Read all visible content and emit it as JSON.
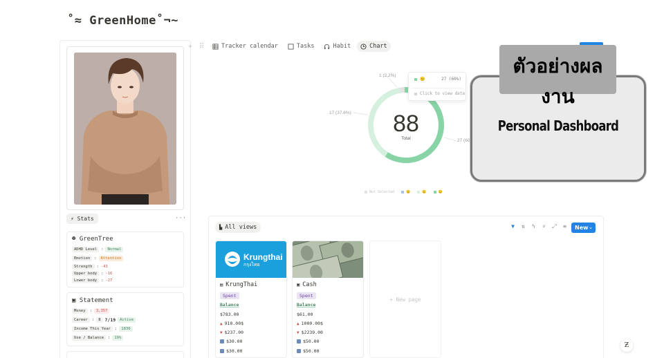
{
  "page": {
    "title": "˚≈ GreenHome˚¬~"
  },
  "toolbar": {
    "tabs": [
      {
        "label": "Tracker calendar",
        "icon": "table-icon",
        "active": false
      },
      {
        "label": "Tasks",
        "icon": "checkbox-icon",
        "active": false
      },
      {
        "label": "Habit",
        "icon": "headphones-icon",
        "active": false
      },
      {
        "label": "Chart",
        "icon": "clock-icon",
        "active": true
      }
    ]
  },
  "stats": {
    "label": "Stats",
    "more": "···"
  },
  "greentree": {
    "title": "GreenTree",
    "rows": [
      {
        "label": "ADHD Level",
        "sep": ":",
        "value": "Normal"
      },
      {
        "label": "Emotion",
        "sep": ":",
        "value": "Attention"
      },
      {
        "label": "Strength",
        "sep": ":",
        "value": "-43"
      },
      {
        "label": "Upper body",
        "sep": ":",
        "value": "-16"
      },
      {
        "label": "Lower body",
        "sep": ":",
        "value": "-27"
      }
    ]
  },
  "statement": {
    "title": "Statement",
    "rows": [
      {
        "label": "Money",
        "sep": ":",
        "value": "3,357"
      },
      {
        "label": "Career",
        "sep": ":",
        "value1": "8",
        "value2": "7/19",
        "value3": "Active"
      },
      {
        "label": "Income This Year",
        "sep": ":",
        "value": "1830"
      },
      {
        "label": "Use / Balance",
        "sep": ":",
        "value": "19%"
      }
    ]
  },
  "chart_data": {
    "type": "pie",
    "total": "88",
    "total_label": "Total",
    "slices": [
      {
        "label": "1 (2.2%)",
        "value": 1,
        "color": "#e3e2e0"
      },
      {
        "label": "17 (37.6%)",
        "value": 17,
        "color": "#d6f0df"
      },
      {
        "label": "27 (60%)",
        "value": 27,
        "color": "#88d4a6"
      }
    ],
    "tooltip": {
      "value": "27 (60%)",
      "hint": "Click to view data"
    },
    "legend": [
      {
        "name": "Not Selected",
        "color": "#e3e2e0"
      },
      {
        "name": "😐",
        "color": "#a7c5e8"
      },
      {
        "name": "😐",
        "color": "#d6f0df"
      },
      {
        "name": "😐",
        "color": "#88d4a6"
      }
    ]
  },
  "overlay": {
    "heading_th": "ตัวอย่างผลงาน",
    "subtitle": "Personal Dashboard"
  },
  "database": {
    "view_label": "All views",
    "new_button": "New",
    "new_page": "+ New page",
    "cards": [
      {
        "title": "KrungThai",
        "brand_en": "Krungthai",
        "brand_th": "กรุงไทย",
        "tag": "Spent",
        "balance_label": "Balance",
        "balance": "$783.00",
        "up": "910.00$",
        "down": "$237.00",
        "item1": "$30.00",
        "item2": "$30.00"
      },
      {
        "title": "Cash",
        "tag": "Spent",
        "balance_label": "Balance",
        "balance": "$61.00",
        "up": "1000.00$",
        "down": "$2239.00",
        "item1": "$50.00",
        "item2": "$50.00"
      }
    ]
  },
  "colors": {
    "accent": "#2383e2",
    "green": "#88d4a6",
    "red": "#d44c47"
  }
}
